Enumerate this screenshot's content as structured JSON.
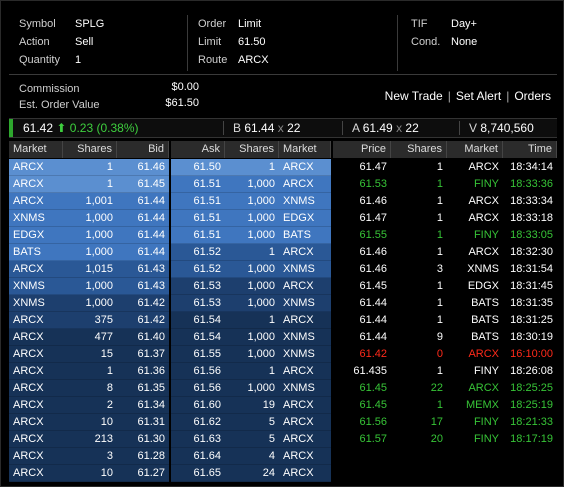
{
  "order": {
    "symbol_label": "Symbol",
    "symbol": "SPLG",
    "action_label": "Action",
    "action": "Sell",
    "quantity_label": "Quantity",
    "quantity": "1",
    "order_label": "Order",
    "order_type": "Limit",
    "limit_label": "Limit",
    "limit": "61.50",
    "route_label": "Route",
    "route": "ARCX",
    "tif_label": "TIF",
    "tif": "Day+",
    "cond_label": "Cond.",
    "cond": "None"
  },
  "cost": {
    "commission_label": "Commission",
    "commission": "$0.00",
    "est_label": "Est. Order Value",
    "est_value": "$61.50"
  },
  "links": {
    "new_trade": "New Trade",
    "set_alert": "Set Alert",
    "orders": "Orders",
    "sep": "|"
  },
  "quote": {
    "last": "61.42",
    "change_arrow": "⬆",
    "change": "0.23 (0.38%)",
    "bid_label": "B",
    "bid": "61.44",
    "x": "x",
    "bid_size": "22",
    "ask_label": "A",
    "ask": "61.49",
    "ask_size": "22",
    "vol_label": "V",
    "volume": "8,740,560"
  },
  "headers": {
    "bid": [
      "Market",
      "Shares",
      "Bid"
    ],
    "ask": [
      "Ask",
      "Shares",
      "Market"
    ],
    "trades": [
      "Price",
      "Shares",
      "Market",
      "Time"
    ]
  },
  "colors": {
    "level1": "#5b8fd0",
    "level2": "#3f76bf",
    "level3": "#2a5896",
    "level4": "#1d3f6e",
    "level5": "#163257",
    "trade_green": "#37c437",
    "trade_red": "#ff2a1a"
  },
  "bids": [
    {
      "m": "ARCX",
      "s": "1",
      "p": "61.46",
      "lvl": 1
    },
    {
      "m": "ARCX",
      "s": "1",
      "p": "61.45",
      "lvl": 1
    },
    {
      "m": "ARCX",
      "s": "1,001",
      "p": "61.44",
      "lvl": 2
    },
    {
      "m": "XNMS",
      "s": "1,000",
      "p": "61.44",
      "lvl": 2
    },
    {
      "m": "EDGX",
      "s": "1,000",
      "p": "61.44",
      "lvl": 2
    },
    {
      "m": "BATS",
      "s": "1,000",
      "p": "61.44",
      "lvl": 2
    },
    {
      "m": "ARCX",
      "s": "1,015",
      "p": "61.43",
      "lvl": 3
    },
    {
      "m": "XNMS",
      "s": "1,000",
      "p": "61.43",
      "lvl": 3
    },
    {
      "m": "XNMS",
      "s": "1,000",
      "p": "61.42",
      "lvl": 4
    },
    {
      "m": "ARCX",
      "s": "375",
      "p": "61.42",
      "lvl": 4
    },
    {
      "m": "ARCX",
      "s": "477",
      "p": "61.40",
      "lvl": 5
    },
    {
      "m": "ARCX",
      "s": "15",
      "p": "61.37",
      "lvl": 5
    },
    {
      "m": "ARCX",
      "s": "1",
      "p": "61.36",
      "lvl": 5
    },
    {
      "m": "ARCX",
      "s": "8",
      "p": "61.35",
      "lvl": 5
    },
    {
      "m": "ARCX",
      "s": "2",
      "p": "61.34",
      "lvl": 5
    },
    {
      "m": "ARCX",
      "s": "10",
      "p": "61.31",
      "lvl": 5
    },
    {
      "m": "ARCX",
      "s": "213",
      "p": "61.30",
      "lvl": 5
    },
    {
      "m": "ARCX",
      "s": "3",
      "p": "61.28",
      "lvl": 5
    },
    {
      "m": "ARCX",
      "s": "10",
      "p": "61.27",
      "lvl": 5
    }
  ],
  "asks": [
    {
      "p": "61.50",
      "s": "1",
      "m": "ARCX",
      "lvl": 1
    },
    {
      "p": "61.51",
      "s": "1,000",
      "m": "ARCX",
      "lvl": 2
    },
    {
      "p": "61.51",
      "s": "1,000",
      "m": "XNMS",
      "lvl": 2
    },
    {
      "p": "61.51",
      "s": "1,000",
      "m": "EDGX",
      "lvl": 2
    },
    {
      "p": "61.51",
      "s": "1,000",
      "m": "BATS",
      "lvl": 2
    },
    {
      "p": "61.52",
      "s": "1",
      "m": "ARCX",
      "lvl": 3
    },
    {
      "p": "61.52",
      "s": "1,000",
      "m": "XNMS",
      "lvl": 3
    },
    {
      "p": "61.53",
      "s": "1,000",
      "m": "ARCX",
      "lvl": 4
    },
    {
      "p": "61.53",
      "s": "1,000",
      "m": "XNMS",
      "lvl": 4
    },
    {
      "p": "61.54",
      "s": "1",
      "m": "ARCX",
      "lvl": 5
    },
    {
      "p": "61.54",
      "s": "1,000",
      "m": "XNMS",
      "lvl": 5
    },
    {
      "p": "61.55",
      "s": "1,000",
      "m": "XNMS",
      "lvl": 5
    },
    {
      "p": "61.56",
      "s": "1",
      "m": "ARCX",
      "lvl": 5
    },
    {
      "p": "61.56",
      "s": "1,000",
      "m": "XNMS",
      "lvl": 5
    },
    {
      "p": "61.60",
      "s": "19",
      "m": "ARCX",
      "lvl": 5
    },
    {
      "p": "61.62",
      "s": "5",
      "m": "ARCX",
      "lvl": 5
    },
    {
      "p": "61.63",
      "s": "5",
      "m": "ARCX",
      "lvl": 5
    },
    {
      "p": "61.64",
      "s": "4",
      "m": "ARCX",
      "lvl": 5
    },
    {
      "p": "61.65",
      "s": "24",
      "m": "ARCX",
      "lvl": 5
    }
  ],
  "trades": [
    {
      "p": "61.47",
      "s": "1",
      "m": "ARCX",
      "t": "18:34:14",
      "c": "white"
    },
    {
      "p": "61.53",
      "s": "1",
      "m": "FINY",
      "t": "18:33:36",
      "c": "green"
    },
    {
      "p": "61.46",
      "s": "1",
      "m": "ARCX",
      "t": "18:33:34",
      "c": "white"
    },
    {
      "p": "61.47",
      "s": "1",
      "m": "ARCX",
      "t": "18:33:18",
      "c": "white"
    },
    {
      "p": "61.55",
      "s": "1",
      "m": "FINY",
      "t": "18:33:05",
      "c": "green"
    },
    {
      "p": "61.46",
      "s": "1",
      "m": "ARCX",
      "t": "18:32:30",
      "c": "white"
    },
    {
      "p": "61.46",
      "s": "3",
      "m": "XNMS",
      "t": "18:31:54",
      "c": "white"
    },
    {
      "p": "61.45",
      "s": "1",
      "m": "EDGX",
      "t": "18:31:45",
      "c": "white"
    },
    {
      "p": "61.44",
      "s": "1",
      "m": "BATS",
      "t": "18:31:35",
      "c": "white"
    },
    {
      "p": "61.44",
      "s": "1",
      "m": "BATS",
      "t": "18:31:25",
      "c": "white"
    },
    {
      "p": "61.44",
      "s": "9",
      "m": "BATS",
      "t": "18:30:19",
      "c": "white"
    },
    {
      "p": "61.42",
      "s": "0",
      "m": "ARCX",
      "t": "16:10:00",
      "c": "red"
    },
    {
      "p": "61.435",
      "s": "1",
      "m": "FINY",
      "t": "18:26:08",
      "c": "white"
    },
    {
      "p": "61.45",
      "s": "22",
      "m": "ARCX",
      "t": "18:25:25",
      "c": "green"
    },
    {
      "p": "61.45",
      "s": "1",
      "m": "MEMX",
      "t": "18:25:19",
      "c": "green"
    },
    {
      "p": "61.56",
      "s": "17",
      "m": "FINY",
      "t": "18:21:33",
      "c": "green"
    },
    {
      "p": "61.57",
      "s": "20",
      "m": "FINY",
      "t": "18:17:19",
      "c": "green"
    }
  ]
}
